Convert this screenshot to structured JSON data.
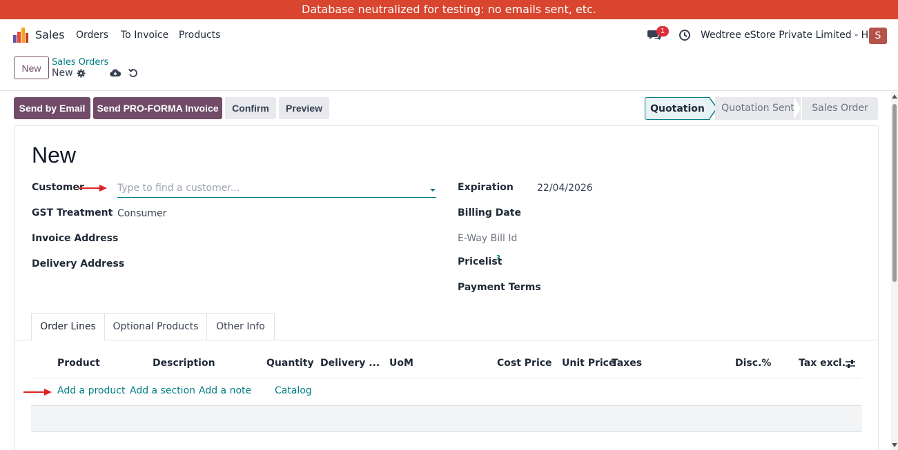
{
  "banner": {
    "text": "Database neutralized for testing: no emails sent, etc."
  },
  "topnav": {
    "app_name": "Sales",
    "menu": [
      "Orders",
      "To Invoice",
      "Products"
    ],
    "chat_badge": "1",
    "company": "Wedtree eStore Private Limited - HO",
    "avatar_letter": "S"
  },
  "control": {
    "new_label": "New",
    "breadcrumb_parent": "Sales Orders",
    "breadcrumb_current": "New"
  },
  "actions": {
    "send_email": "Send by Email",
    "send_proforma": "Send PRO-FORMA Invoice",
    "confirm": "Confirm",
    "preview": "Preview"
  },
  "statusbar": {
    "stages": [
      "Quotation",
      "Quotation Sent",
      "Sales Order"
    ],
    "active_stage": "Quotation"
  },
  "form": {
    "title": "New",
    "customer_label": "Customer",
    "customer_placeholder": "Type to find a customer...",
    "gst_label": "GST Treatment",
    "gst_value": "Consumer",
    "invoice_address_label": "Invoice Address",
    "delivery_address_label": "Delivery Address",
    "expiration_label": "Expiration",
    "expiration_value": "22/04/2026",
    "billing_date_label": "Billing Date",
    "eway_label": "E-Way Bill Id",
    "pricelist_label": "Pricelist",
    "pricelist_help": "?",
    "payment_terms_label": "Payment Terms"
  },
  "tabs": [
    "Order Lines",
    "Optional Products",
    "Other Info"
  ],
  "order_lines": {
    "columns": [
      "Product",
      "Description",
      "Quantity",
      "Delivery ...",
      "UoM",
      "Cost Price",
      "Unit Price",
      "Taxes",
      "Disc.%",
      "Tax excl."
    ],
    "add_links": [
      "Add a product",
      "Add a section",
      "Add a note",
      "Catalog"
    ]
  },
  "colors": {
    "brand": "#714b67",
    "accent": "#017e84",
    "banner": "#d9452e"
  }
}
